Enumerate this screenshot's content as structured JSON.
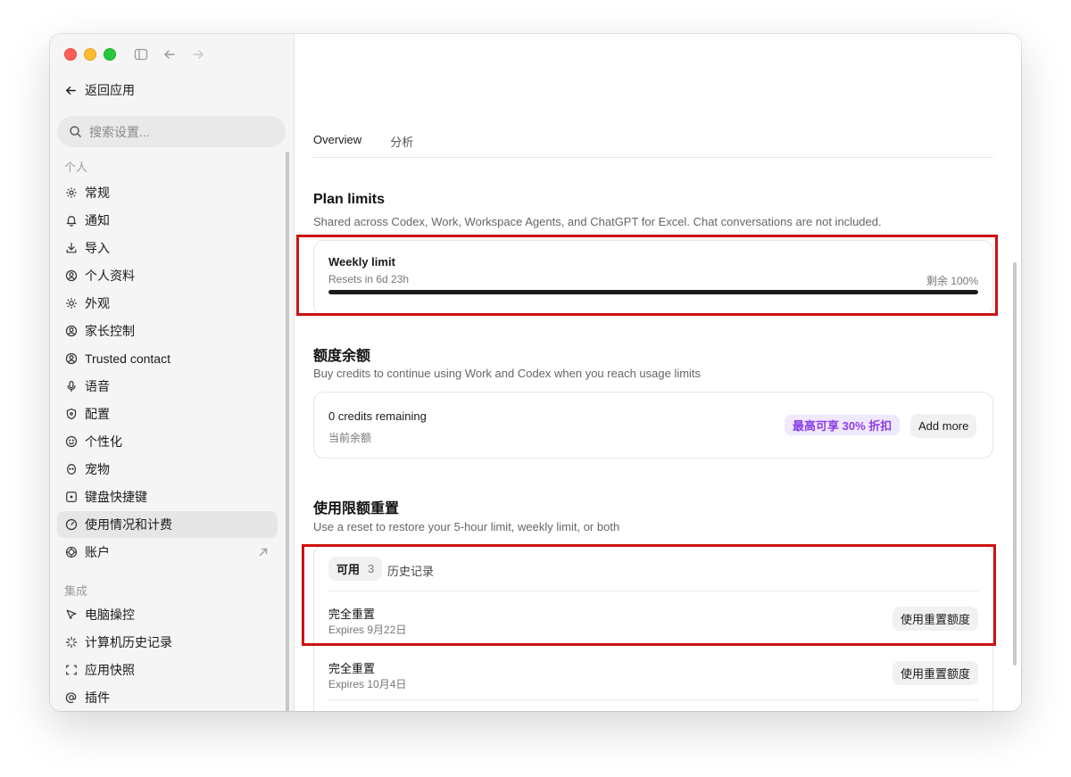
{
  "window": {
    "back_label": "返回应用"
  },
  "search": {
    "placeholder": "搜索设置..."
  },
  "sidebar": {
    "personal_label": "个人",
    "items": [
      {
        "label": "常规",
        "icon": "gear-icon"
      },
      {
        "label": "通知",
        "icon": "bell-icon"
      },
      {
        "label": "导入",
        "icon": "download-icon"
      },
      {
        "label": "个人资料",
        "icon": "user-circle-icon"
      },
      {
        "label": "外观",
        "icon": "sun-icon"
      },
      {
        "label": "家长控制",
        "icon": "user-circle-icon"
      },
      {
        "label": "Trusted contact",
        "icon": "user-circle-icon"
      },
      {
        "label": "语音",
        "icon": "microphone-icon"
      },
      {
        "label": "配置",
        "icon": "shield-icon"
      },
      {
        "label": "个性化",
        "icon": "smile-icon"
      },
      {
        "label": "宠物",
        "icon": "pet-icon"
      },
      {
        "label": "键盘快捷键",
        "icon": "keyboard-icon"
      },
      {
        "label": "使用情况和计费",
        "icon": "gauge-icon",
        "active": true
      },
      {
        "label": "账户",
        "icon": "openai-icon",
        "external": true
      }
    ],
    "integrations_label": "集成",
    "integrations": [
      {
        "label": "电脑操控",
        "icon": "cursor-icon"
      },
      {
        "label": "计算机历史记录",
        "icon": "sparkle-icon"
      },
      {
        "label": "应用快照",
        "icon": "screenshot-icon"
      },
      {
        "label": "插件",
        "icon": "at-icon"
      }
    ]
  },
  "tabs": [
    {
      "label": "Overview",
      "active": true
    },
    {
      "label": "分析",
      "active": false
    }
  ],
  "plan_limits": {
    "title": "Plan limits",
    "description": "Shared across Codex, Work, Workspace Agents, and ChatGPT for Excel. Chat conversations are not included.",
    "weekly": {
      "title": "Weekly limit",
      "resets": "Resets in 6d 23h",
      "remaining_label": "剩余 100%",
      "remaining_fraction": 1.0
    }
  },
  "credits": {
    "title": "额度余额",
    "description": "Buy credits to continue using Work and Codex when you reach usage limits",
    "remaining": "0 credits remaining",
    "sub": "当前余额",
    "discount_badge": "最高可享 30% 折扣",
    "add_more": "Add more"
  },
  "resets": {
    "title": "使用限额重置",
    "description": "Use a reset to restore your 5-hour limit, weekly limit, or both",
    "tab_available": "可用",
    "tab_available_count": "3",
    "tab_history": "历史记录",
    "rows": [
      {
        "title": "完全重置",
        "expires": "Expires 9月22日",
        "button": "使用重置额度"
      },
      {
        "title": "完全重置",
        "expires": "Expires 10月4日",
        "button": "使用重置额度"
      }
    ]
  },
  "colors": {
    "highlight": "#cc1212",
    "discount_text": "#8a3ee6",
    "discount_bg": "#f0e8fd"
  }
}
